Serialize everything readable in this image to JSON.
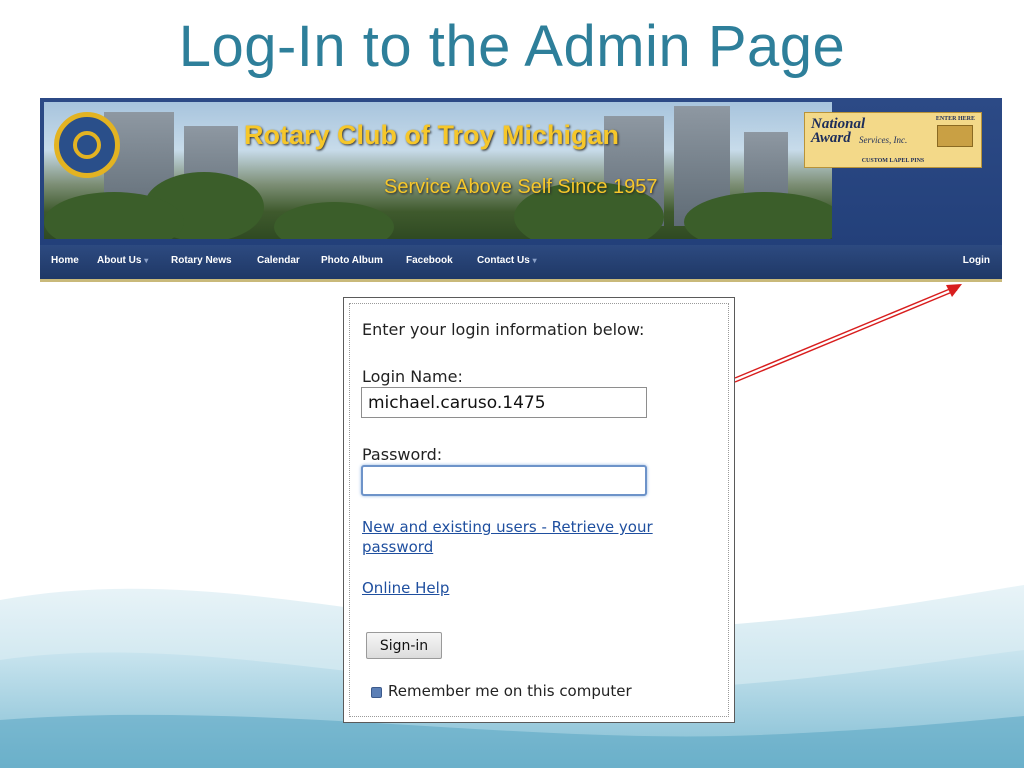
{
  "slide": {
    "title": "Log-In to the Admin Page"
  },
  "site": {
    "club_name": "Rotary Club of Troy Michigan",
    "motto": "Service Above Self Since 1957",
    "ad": {
      "brand": "National Award",
      "services": "Services, Inc.",
      "enter": "ENTER HERE",
      "tagline": "CUSTOM LAPEL PINS"
    },
    "nav": {
      "items": [
        "Home",
        "About Us",
        "Rotary News",
        "Calendar",
        "Photo Album",
        "Facebook",
        "Contact Us"
      ],
      "login": "Login"
    }
  },
  "login": {
    "intro": "Enter your login information below:",
    "name_label": "Login Name:",
    "name_value": "michael.caruso.1475",
    "password_label": "Password:",
    "password_value": "",
    "retrieve_link": "New and existing users - Retrieve your password",
    "help_link": "Online Help",
    "signin_label": "Sign-in",
    "remember_label": "Remember me on this computer",
    "remember_checked": true
  },
  "colors": {
    "title": "#2e7f9a",
    "banner": "#23407a",
    "club_text": "#f6c72a",
    "link": "#1f4f9f",
    "arrow": "#d81e1e"
  }
}
